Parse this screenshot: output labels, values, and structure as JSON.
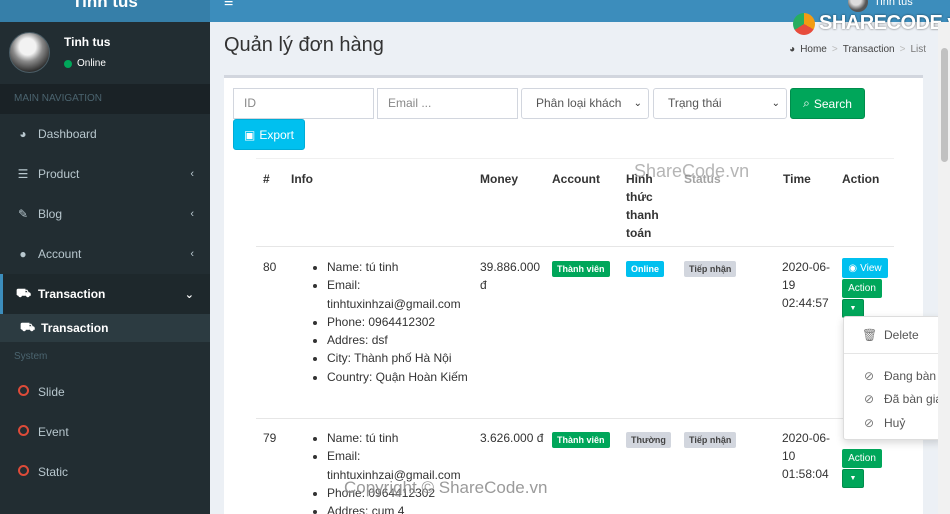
{
  "header": {
    "logo_text": "Tinh tus",
    "user_name": "Tinh tus"
  },
  "sidebar": {
    "user": {
      "name": "Tinh tus",
      "status": "Online"
    },
    "main_nav_header": "MAIN NAVIGATION",
    "items": [
      {
        "label": "Dashboard",
        "icon": "dashboard-icon"
      },
      {
        "label": "Product",
        "icon": "database-icon"
      },
      {
        "label": "Blog",
        "icon": "edit-icon"
      },
      {
        "label": "Account",
        "icon": "user-icon"
      },
      {
        "label": "Transaction",
        "icon": "cart-icon"
      }
    ],
    "sub_item": "Transaction",
    "system_header": "System",
    "system_items": [
      {
        "label": "Slide"
      },
      {
        "label": "Event"
      },
      {
        "label": "Static"
      }
    ]
  },
  "page": {
    "title": "Quản lý đơn hàng",
    "breadcrumb": [
      "Home",
      "Transaction",
      "List"
    ]
  },
  "filters": {
    "id_placeholder": "ID",
    "email_placeholder": "Email ...",
    "customer_type": "Phân loại khách",
    "status": "Trạng thái",
    "search_label": "Search",
    "export_label": "Export"
  },
  "table": {
    "columns": [
      "#",
      "Info",
      "Money",
      "Account",
      "Hình thức thanh toán",
      "Status",
      "Time",
      "Action"
    ],
    "payment_col_lines": [
      "Hình",
      "thức",
      "thanh",
      "toán"
    ],
    "rows": [
      {
        "id": "80",
        "info": [
          "Name: tú tinh",
          "Email: tinhtuxinhzai@gmail.com",
          "Phone: 0964412302",
          "Addres: dsf",
          "City: Thành phố Hà Nội",
          "Country: Quận Hoàn Kiếm"
        ],
        "money": "39.886.000 đ",
        "account": "Thành viên",
        "payment": "Online",
        "status": "Tiếp nhận",
        "time": "2020-06-19 02:44:57"
      },
      {
        "id": "79",
        "info": [
          "Name: tú tinh",
          "Email: tinhtuxinhzai@gmail.com",
          "Phone: 0964412302",
          "Addres: cụm 4"
        ],
        "money": "3.626.000 đ",
        "account": "Thành viên",
        "payment": "Thường",
        "status": "Tiếp nhận",
        "time": "2020-06-10 01:58:04"
      }
    ],
    "view_label": "View",
    "action_label": "Action"
  },
  "dropdown": {
    "items": [
      "Delete",
      "Đang bàn",
      "Đã bàn gia",
      "Huỷ"
    ]
  },
  "watermarks": {
    "logo": "SHARECODE.vn",
    "mid": "ShareCode.vn",
    "bottom": "Copyright © ShareCode.vn"
  },
  "colors": {
    "header": "#3c8dbc",
    "sidebar": "#222d32",
    "success": "#00a65a",
    "info": "#00c0ef"
  }
}
